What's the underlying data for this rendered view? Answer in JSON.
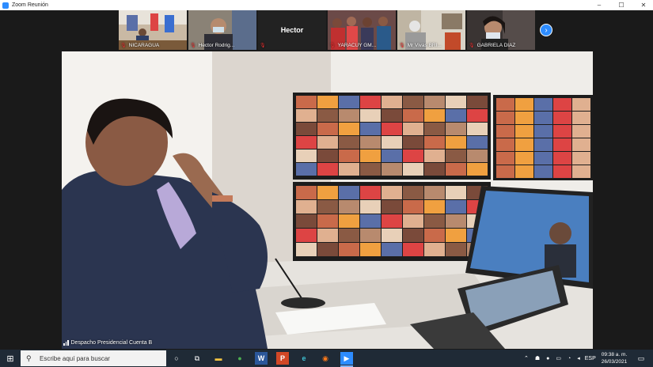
{
  "window": {
    "title": "Zoom Reunión",
    "controls": {
      "minimize": "–",
      "maximize": "☐",
      "close": "✕"
    }
  },
  "thumbnails": [
    {
      "name": "NICARAGUA",
      "muted": true
    },
    {
      "name": "Hector Rodrig...",
      "muted": true
    },
    {
      "name": "Hector",
      "muted": true,
      "video_off": true
    },
    {
      "name": "YARACUY GM...",
      "muted": true
    },
    {
      "name": "Mr Vivas BRI...",
      "muted": true
    },
    {
      "name": "GABRIELA DIAZ",
      "muted": true
    }
  ],
  "next_page_icon": "›",
  "main": {
    "speaker_name": "Despacho Presidencial Cuenta B"
  },
  "taskbar": {
    "search_placeholder": "Escribe aquí para buscar",
    "apps": [
      {
        "name": "task-view",
        "glyph": "○"
      },
      {
        "name": "taskview-timeline",
        "glyph": "⧉"
      },
      {
        "name": "file-explorer",
        "glyph": "▬"
      },
      {
        "name": "chrome",
        "glyph": "●"
      },
      {
        "name": "word",
        "glyph": "W"
      },
      {
        "name": "powerpoint",
        "glyph": "P"
      },
      {
        "name": "edge",
        "glyph": "e"
      },
      {
        "name": "firefox",
        "glyph": "◉"
      },
      {
        "name": "zoom",
        "glyph": "▶"
      }
    ],
    "language": "ESP",
    "time": "09:38 a. m.",
    "date": "26/03/2021"
  },
  "colors": {
    "zoom_bg": "#1a1a1a",
    "accent": "#2d8cff",
    "taskbar": "#1f2a36",
    "muted": "#e33333"
  }
}
